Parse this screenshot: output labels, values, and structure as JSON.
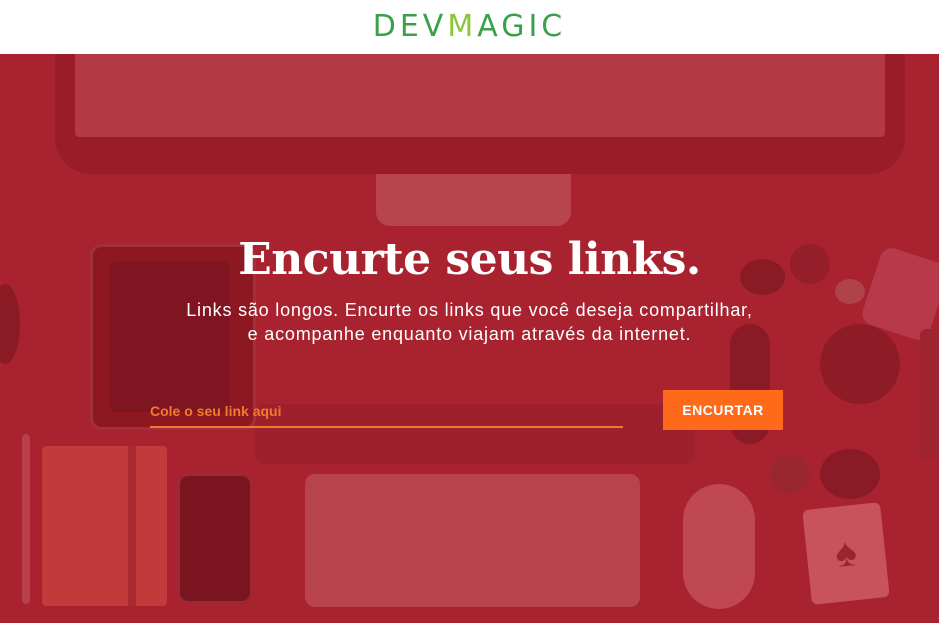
{
  "header": {
    "logo_dev": "DEV",
    "logo_v": "M",
    "logo_rest": "AGIC"
  },
  "hero": {
    "headline": "Encurte seus links.",
    "subtitle_line1": "Links são longos. Encurte os links que você deseja compartilhar,",
    "subtitle_line2": "e acompanhe enquanto viajam através da internet.",
    "input_placeholder": "Cole o seu link aqui",
    "input_value": "",
    "button_label": "ENCURTAR"
  },
  "colors": {
    "brand_green": "#3aa14a",
    "hero_red": "#a8232f",
    "accent_orange": "#ff6a1a"
  },
  "icons": {
    "card_suit": "spade-icon"
  }
}
